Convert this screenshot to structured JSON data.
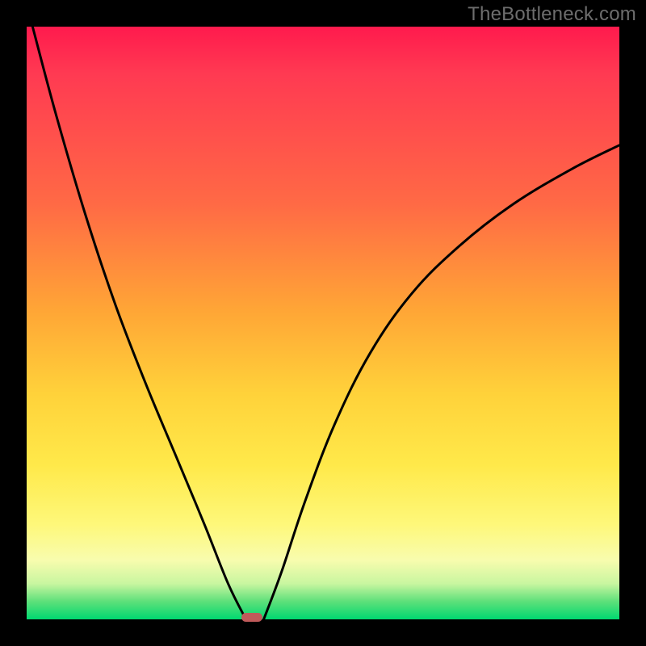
{
  "watermark": "TheBottleneck.com",
  "chart_data": {
    "type": "line",
    "title": "",
    "xlabel": "",
    "ylabel": "",
    "xlim": [
      0,
      100
    ],
    "ylim": [
      0,
      100
    ],
    "grid": false,
    "legend": false,
    "gradient_stops": [
      {
        "pos": 0,
        "color": "#ff1a4d"
      },
      {
        "pos": 30,
        "color": "#ff6a45"
      },
      {
        "pos": 62,
        "color": "#ffd23a"
      },
      {
        "pos": 90,
        "color": "#f8fcae"
      },
      {
        "pos": 100,
        "color": "#00d870"
      }
    ],
    "series": [
      {
        "name": "left-branch",
        "x": [
          1,
          5,
          10,
          15,
          20,
          25,
          30,
          34,
          37
        ],
        "y": [
          100,
          85,
          68,
          53,
          40,
          28,
          16,
          6,
          0
        ]
      },
      {
        "name": "right-branch",
        "x": [
          40,
          43,
          47,
          52,
          58,
          65,
          73,
          82,
          92,
          100
        ],
        "y": [
          0,
          8,
          20,
          33,
          45,
          55,
          63,
          70,
          76,
          80
        ]
      }
    ],
    "marker": {
      "name": "optimal-point",
      "x": 38,
      "y": 0,
      "width_pct": 3.6,
      "height_pct": 1.5,
      "color": "#c05a5a"
    }
  }
}
